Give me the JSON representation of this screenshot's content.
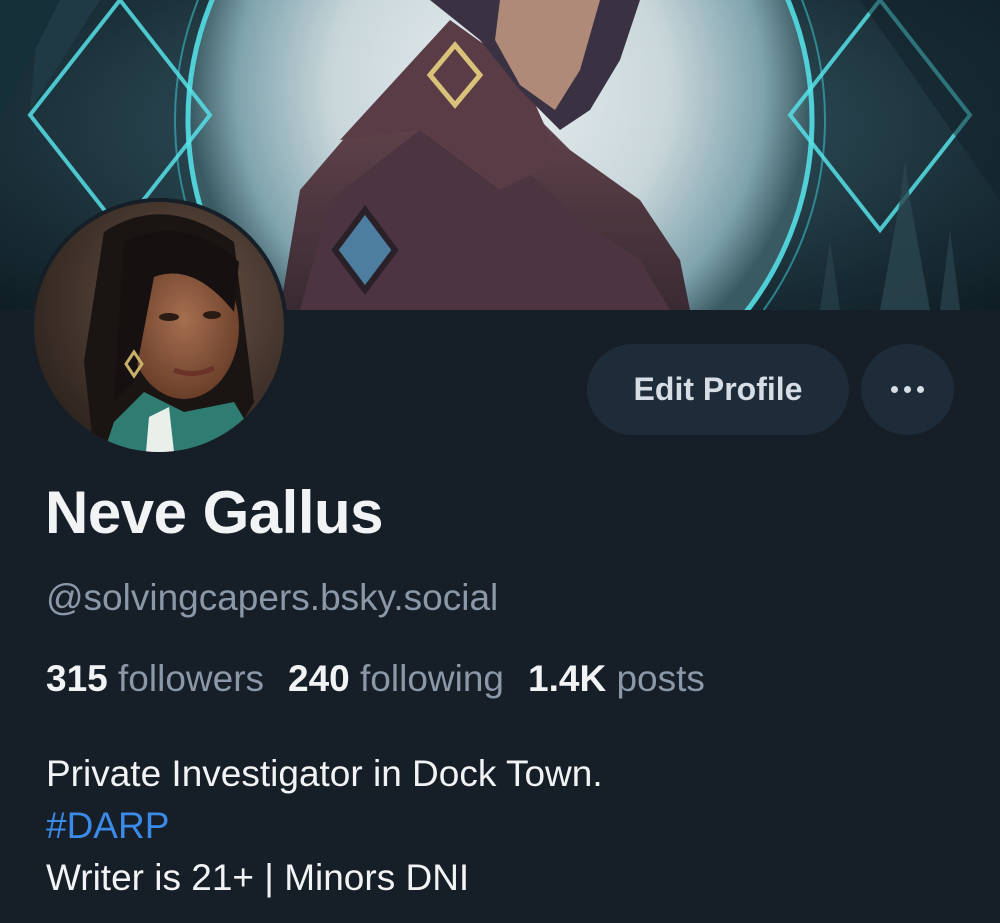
{
  "profile": {
    "display_name": "Neve Gallus",
    "handle": "@solvingcapers.bsky.social",
    "edit_button_label": "Edit Profile",
    "more_icon": "ellipsis-icon",
    "stats": {
      "followers_count": "315",
      "followers_label": "followers",
      "following_count": "240",
      "following_label": "following",
      "posts_count": "1.4K",
      "posts_label": "posts"
    },
    "bio": {
      "line1": "Private Investigator in Dock Town.",
      "hashtag": "#DARP",
      "line3": "Writer is 21+ | Minors DNI"
    }
  },
  "colors": {
    "background": "#161e27",
    "button_bg": "#1e2b38",
    "primary_text": "#f1f3f5",
    "secondary_text": "#8a98a8",
    "link": "#3b8ae8"
  }
}
